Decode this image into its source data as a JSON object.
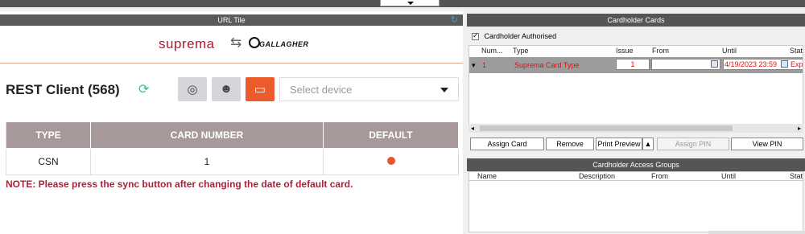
{
  "url_tile": {
    "title": "URL Tile",
    "logo_left": "suprema",
    "logo_swap": "⇆",
    "logo_right": "GALLAGHER"
  },
  "rest_client": {
    "title": "REST Client (568)",
    "select_placeholder": "Select device"
  },
  "card_table": {
    "headers": [
      "TYPE",
      "CARD NUMBER",
      "DEFAULT"
    ],
    "rows": [
      {
        "type": "CSN",
        "card_number": "1",
        "default": true
      }
    ]
  },
  "note": "NOTE: Please press the sync button after changing the date of default card.",
  "cardholder_cards": {
    "title": "Cardholder Cards",
    "authorised_label": "Cardholder Authorised",
    "authorised_checked": true,
    "columns": [
      "Num...",
      "Type",
      "Issue",
      "From",
      "Until",
      "Stat"
    ],
    "row": {
      "num": "1",
      "type": "Suprema Card Type",
      "issue": "1",
      "from": "",
      "until": "4/19/2023 23:59",
      "status": "Exp"
    },
    "buttons": {
      "assign_card": "Assign Card",
      "remove": "Remove",
      "print_preview": "Print Preview",
      "assign_pin": "Assign PIN",
      "view_pin": "View PIN"
    }
  },
  "access_groups": {
    "title": "Cardholder Access Groups",
    "columns": [
      "Name",
      "Description",
      "From",
      "Until",
      "Stat"
    ]
  },
  "colors": {
    "accent_orange": "#ec5b2b",
    "suprema_red": "#b5192c",
    "note_red": "#a8233a",
    "table_header": "#a79899"
  }
}
